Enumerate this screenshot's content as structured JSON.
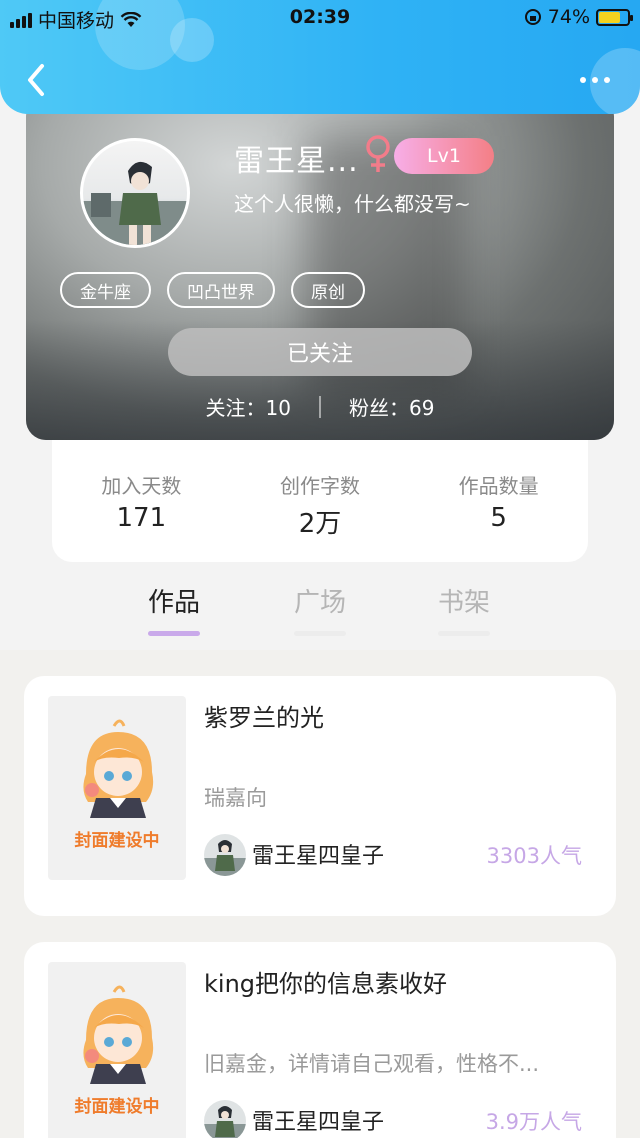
{
  "status_bar": {
    "carrier": "中国移动",
    "time": "02:39",
    "battery": "74%",
    "battery_level": 0.74
  },
  "profile": {
    "nickname": "雷王星...",
    "gender_icon": "female-icon",
    "level": "Lv1",
    "bio": "这个人很懒，什么都没写~",
    "tags": [
      "金牛座",
      "凹凸世界",
      "原创"
    ],
    "follow_button": "已关注",
    "following": "关注：10",
    "followers": "粉丝：69"
  },
  "stats": [
    {
      "label": "加入天数",
      "value": "171"
    },
    {
      "label": "创作字数",
      "value": "2万"
    },
    {
      "label": "作品数量",
      "value": "5"
    }
  ],
  "tabs": [
    {
      "label": "作品",
      "active": true
    },
    {
      "label": "广场",
      "active": false
    },
    {
      "label": "书架",
      "active": false
    }
  ],
  "works": [
    {
      "cover_caption": "封面建设中",
      "title": "紫罗兰的光",
      "desc": "瑞嘉向",
      "author": "雷王星四皇子",
      "popularity": "3303人气"
    },
    {
      "cover_caption": "封面建设中",
      "title": "king把你的信息素收好",
      "desc": "旧嘉金，详情请自己观看，性格不...",
      "author": "雷王星四皇子",
      "popularity": "3.9万人气"
    }
  ],
  "colors": {
    "topbar": "#2fb2f5",
    "level_badge": "#f47f86",
    "tab_underline": "#c9a9ea",
    "popularity": "#c6a7e6",
    "cover_caption": "#ef7c2c"
  }
}
